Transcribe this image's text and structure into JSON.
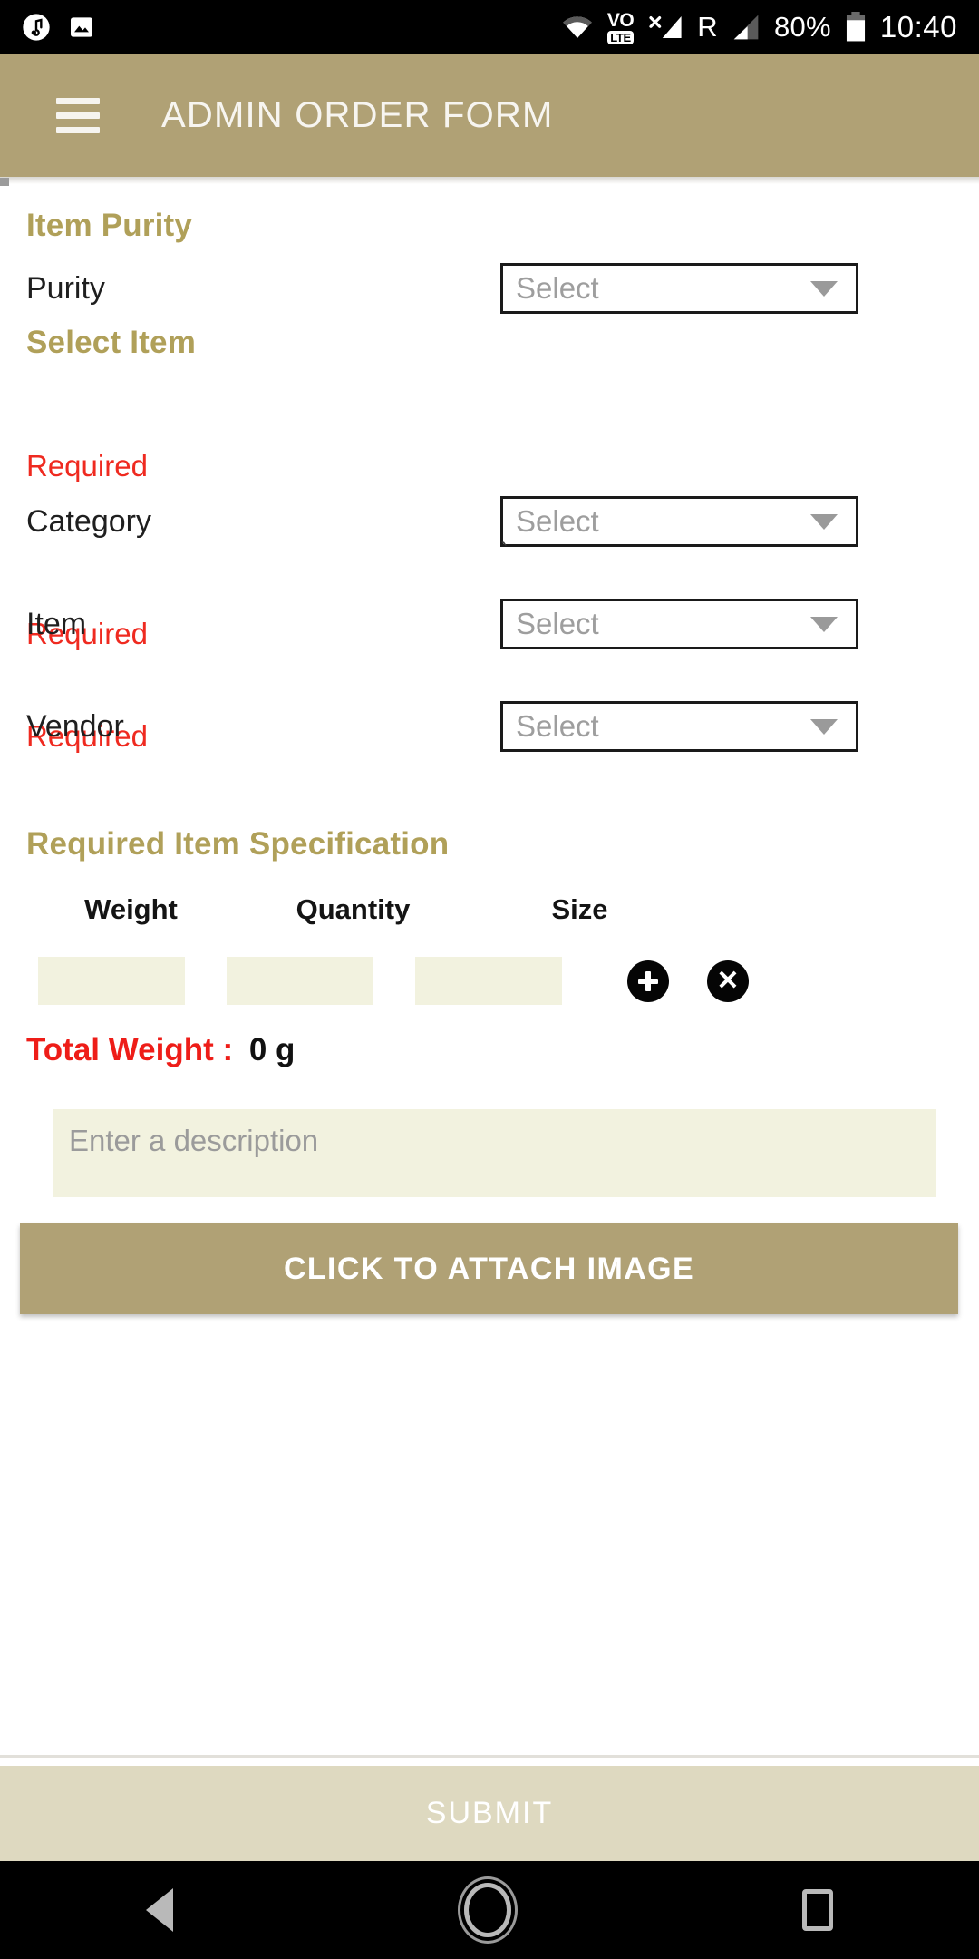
{
  "status_bar": {
    "left_icons": [
      "music-note-icon",
      "image-icon"
    ],
    "wifi_icon": "wifi-icon",
    "volte_label": "VO",
    "volte_badge": "LTE",
    "signal_x_icon": "signal-no-service-icon",
    "roaming_label": "R",
    "signal_icon": "signal-bars-icon",
    "battery_percent": "80%",
    "battery_icon": "battery-icon",
    "time": "10:40"
  },
  "app_bar": {
    "menu_icon": "hamburger-menu-icon",
    "title": "ADMIN ORDER FORM"
  },
  "sections": {
    "item_purity": {
      "heading": "Item Purity",
      "purity": {
        "label": "Purity",
        "placeholder": "Select",
        "error": "Required"
      }
    },
    "select_item": {
      "heading": "Select Item",
      "category": {
        "label": "Category",
        "placeholder": "Select",
        "error": "Required",
        "stray_char": "`"
      },
      "item": {
        "label": "Item",
        "placeholder": "Select",
        "error": "Required"
      },
      "vendor": {
        "label": "Vendor",
        "placeholder": "Select"
      }
    },
    "specification": {
      "heading": "Required Item Specification",
      "columns": [
        "Weight",
        "Quantity",
        "Size"
      ],
      "rows": [
        {
          "weight": "",
          "quantity": "",
          "size": ""
        }
      ],
      "add_icon": "plus-circle-icon",
      "remove_icon": "close-circle-icon",
      "total_weight_label": "Total Weight :",
      "total_weight_value": "0 g"
    },
    "description": {
      "placeholder": "Enter a description",
      "value": ""
    },
    "attach": {
      "label": "CLICK TO ATTACH IMAGE"
    }
  },
  "submit": {
    "label": "SUBMIT"
  },
  "nav_bar": {
    "back_icon": "back-triangle-icon",
    "home_icon": "home-circle-icon",
    "recents_icon": "recents-square-icon"
  },
  "colors": {
    "brand": "#b0a175",
    "heading": "#b0a059",
    "error": "#ef2a20",
    "input_fill": "#f2f2df",
    "submit_bg": "#ded9c0"
  }
}
